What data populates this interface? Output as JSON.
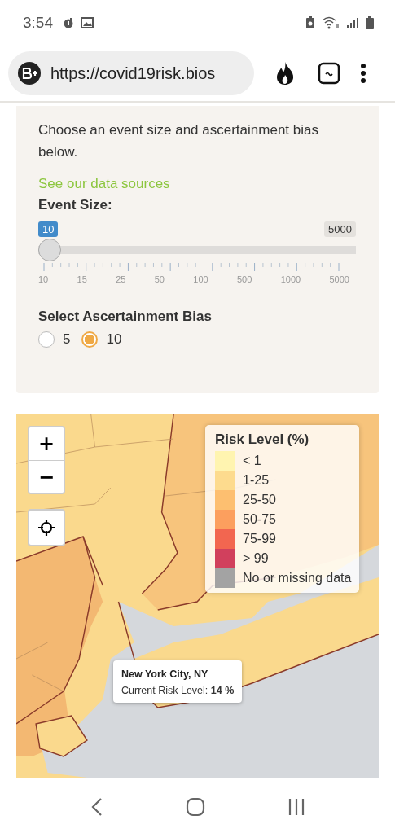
{
  "status_bar": {
    "time": "3:54"
  },
  "browser": {
    "url": "https://covid19risk.bios"
  },
  "controls": {
    "intro": "Choose an event size and ascertainment bias below.",
    "link": "See our data sources",
    "event_size": {
      "label": "Event Size:",
      "value": "10",
      "max": "5000",
      "level": 0,
      "ticks": [
        "10",
        "15",
        "25",
        "50",
        "100",
        "500",
        "1000",
        "5000"
      ]
    },
    "bias": {
      "label": "Select Ascertainment Bias",
      "options": [
        {
          "label": "5",
          "selected": false
        },
        {
          "label": "10",
          "selected": true
        }
      ]
    }
  },
  "map": {
    "zoom_in": "+",
    "zoom_out": "−",
    "legend": {
      "title": "Risk Level (%)",
      "items": [
        {
          "label": "< 1",
          "color": "#fff4b0"
        },
        {
          "label": "1-25",
          "color": "#fddb8e"
        },
        {
          "label": "25-50",
          "color": "#fdbf70"
        },
        {
          "label": "50-75",
          "color": "#fc9f5e"
        },
        {
          "label": "75-99",
          "color": "#f26650"
        },
        {
          "label": "> 99",
          "color": "#d1405d"
        },
        {
          "label": "No or missing data",
          "color": "#a3a3a3"
        }
      ]
    },
    "tooltip": {
      "title": "New York City, NY",
      "text": "Current Risk Level: **14 %**"
    }
  }
}
